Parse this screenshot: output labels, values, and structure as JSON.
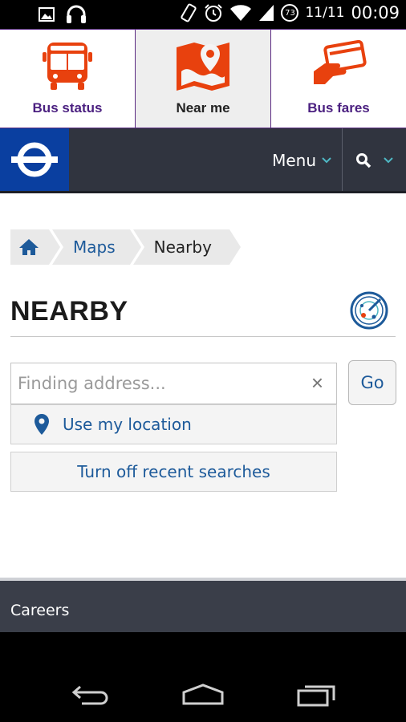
{
  "status_bar": {
    "date": "11/11",
    "time": "00:09",
    "battery": "73",
    "icons": [
      "image-icon",
      "headphones-icon",
      "vibrate-icon",
      "alarm-icon",
      "wifi-icon",
      "signal-icon",
      "battery-icon"
    ]
  },
  "tiles": [
    {
      "label": "Bus status",
      "icon": "bus-icon"
    },
    {
      "label": "Near me",
      "icon": "map-pin-icon"
    },
    {
      "label": "Bus fares",
      "icon": "card-payment-icon"
    }
  ],
  "nav": {
    "menu_label": "Menu",
    "logo": "roundel-logo",
    "search_icon": "search-icon"
  },
  "breadcrumb": {
    "home_icon": "home-icon",
    "items": [
      "Maps",
      "Nearby"
    ]
  },
  "page": {
    "title": "NEARBY",
    "title_icon": "radar-icon"
  },
  "search": {
    "placeholder": "Finding address...",
    "value": "",
    "go_label": "Go",
    "clear_glyph": "×"
  },
  "options": {
    "use_location": "Use my location",
    "recent_searches": "Turn off recent searches"
  },
  "footer": {
    "link": "Careers"
  },
  "colors": {
    "tfl_orange": "#e8410e",
    "tfl_purple": "#4b2080",
    "tfl_blue": "#0a3fa0",
    "link_blue": "#1d5a9a",
    "nav_dark": "#30343f",
    "teal_accent": "#4fb8c4"
  }
}
